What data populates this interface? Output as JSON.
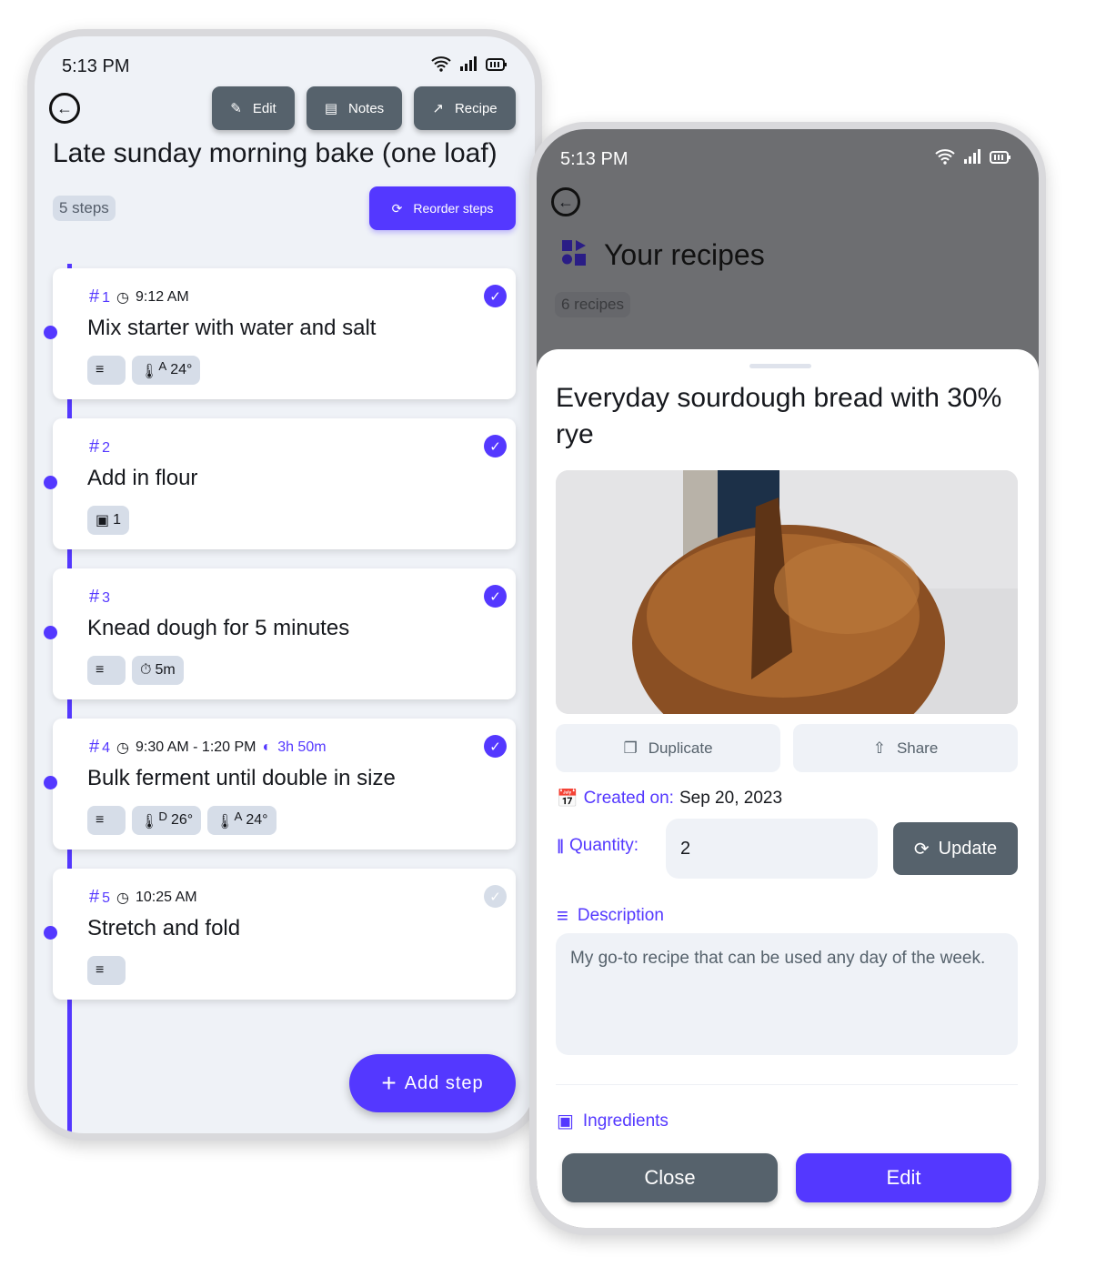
{
  "left_screen": {
    "status_time": "5:13 PM",
    "toolbar": {
      "edit_label": "Edit",
      "notes_label": "Notes",
      "recipe_label": "Recipe"
    },
    "title": "Late sunday morning bake (one loaf)",
    "step_count": "5 steps",
    "reorder_label": "Reorder steps",
    "steps": [
      {
        "num": "1",
        "time": "9:12 AM",
        "duration": "",
        "title": "Mix starter with water and salt",
        "done": true,
        "tags": [
          "notes",
          "ambient-temp 24°"
        ]
      },
      {
        "num": "2",
        "time": "",
        "duration": "",
        "title": "Add in flour",
        "done": true,
        "tags": [
          "images 1"
        ]
      },
      {
        "num": "3",
        "time": "",
        "duration": "",
        "title": "Knead dough for 5 minutes",
        "done": true,
        "tags": [
          "notes",
          "timer 5m"
        ]
      },
      {
        "num": "4",
        "time": "9:30 AM - 1:20 PM",
        "duration": "3h 50m",
        "title": "Bulk ferment until double in size",
        "done": true,
        "tags": [
          "notes",
          "dough-temp 26°",
          "ambient-temp 24°"
        ]
      },
      {
        "num": "5",
        "time": "10:25 AM",
        "duration": "",
        "title": "Stretch and fold",
        "done": false,
        "tags": [
          "notes"
        ]
      }
    ],
    "tag_values": {
      "s1_temp_a": "24°",
      "s2_images": "1",
      "s3_timer": "5m",
      "s4_temp_d": "26°",
      "s4_temp_a": "24°",
      "sup_a": "A",
      "sup_d": "D"
    },
    "add_step_label": "Add step"
  },
  "right_screen": {
    "status_time": "5:13 PM",
    "page_title": "Your recipes",
    "recipe_count": "6 recipes",
    "sheet": {
      "title": "Everyday sourdough bread with 30% rye",
      "duplicate_label": "Duplicate",
      "share_label": "Share",
      "created_label": "Created on:",
      "created_value": "Sep 20, 2023",
      "quantity_label": "Quantity:",
      "quantity_value": "2",
      "update_label": "Update",
      "description_label": "Description",
      "description_text": "My go-to recipe that can be used any day of the week.",
      "ingredients_label": "Ingredients",
      "close_label": "Close",
      "edit_label": "Edit"
    }
  },
  "colors": {
    "accent": "#5438ff",
    "slate": "#56626c",
    "surface": "#eff2f7",
    "chip": "#d6dde8"
  }
}
